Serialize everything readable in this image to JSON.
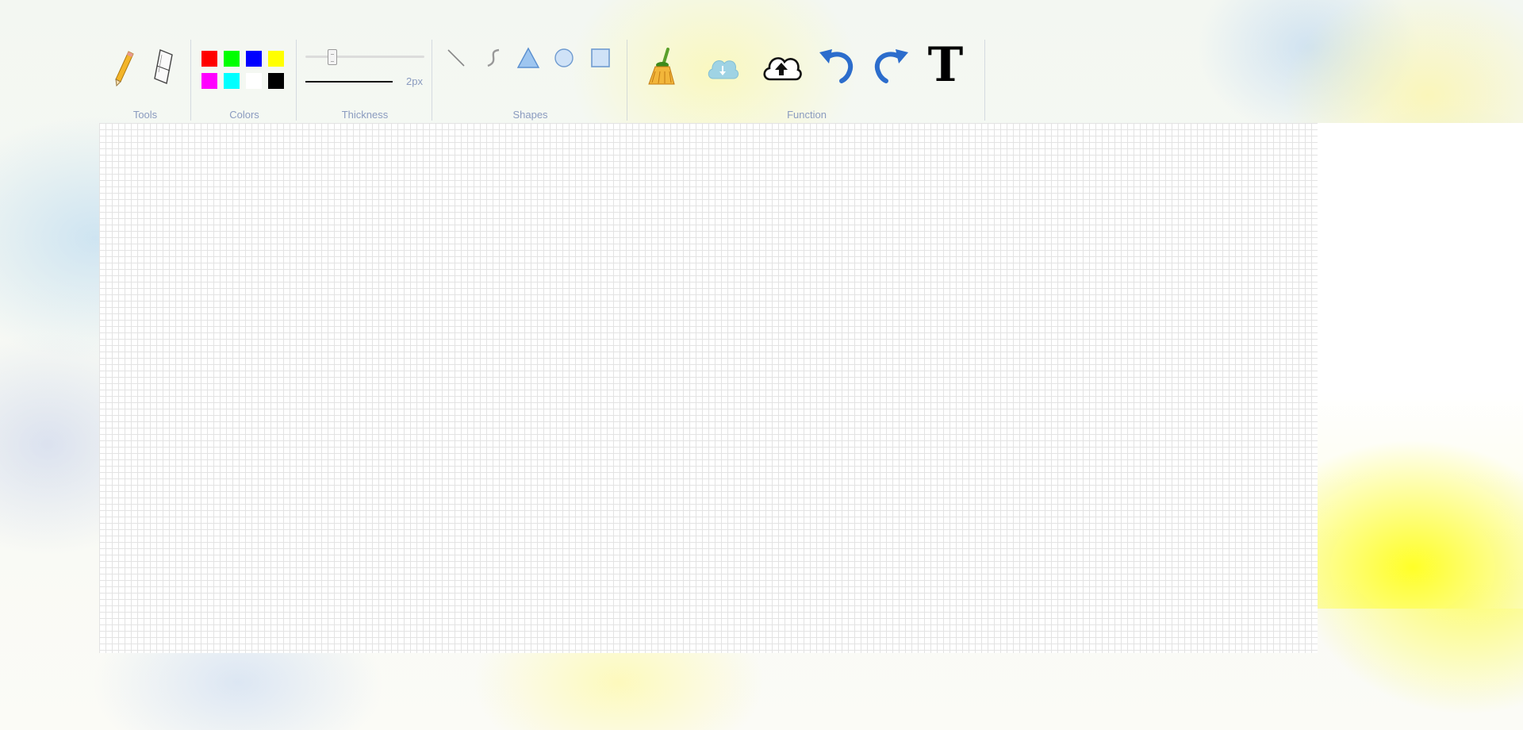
{
  "toolbar": {
    "groups": {
      "tools": "Tools",
      "colors": "Colors",
      "thickness": "Thickness",
      "shapes": "Shapes",
      "function": "Function"
    },
    "tools": [
      {
        "name": "pencil-icon"
      },
      {
        "name": "eraser-icon"
      }
    ],
    "colors": [
      "#ff0000",
      "#00ff00",
      "#0000ff",
      "#ffff00",
      "#ff00ff",
      "#00ffff",
      "#ffffff",
      "#000000"
    ],
    "thickness": {
      "value": 2,
      "label": "2px"
    },
    "shapes": [
      {
        "name": "line-icon"
      },
      {
        "name": "curve-icon"
      },
      {
        "name": "triangle-icon"
      },
      {
        "name": "circle-icon"
      },
      {
        "name": "rectangle-icon"
      }
    ],
    "functions": [
      {
        "name": "broom-icon"
      },
      {
        "name": "cloud-download-icon"
      },
      {
        "name": "cloud-upload-icon"
      },
      {
        "name": "undo-icon"
      },
      {
        "name": "redo-icon"
      },
      {
        "name": "text-icon",
        "glyph": "T"
      }
    ]
  }
}
